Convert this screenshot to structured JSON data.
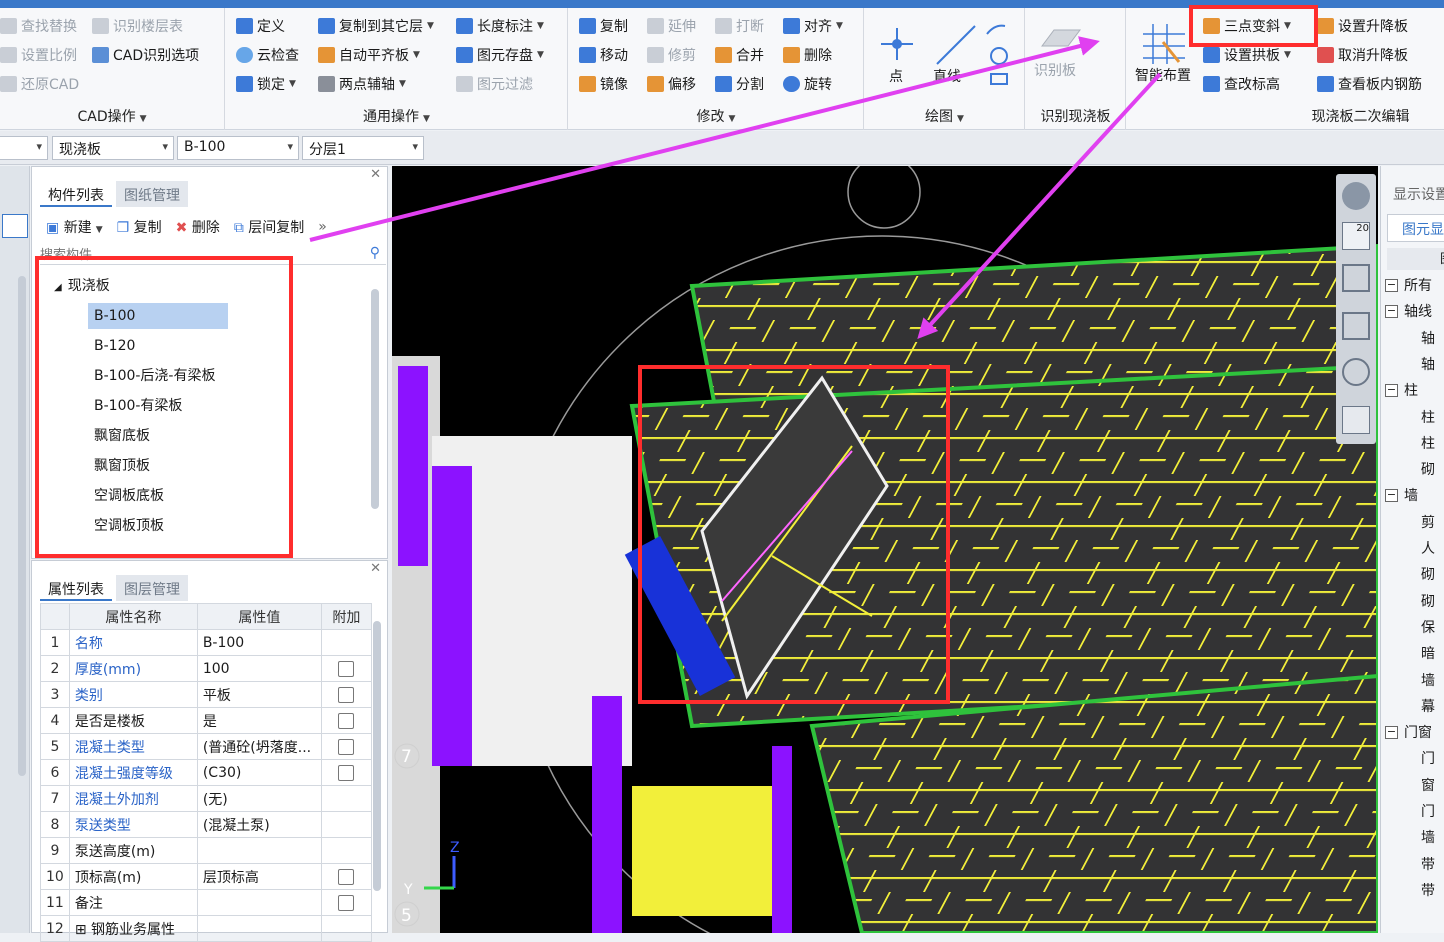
{
  "ribbon": {
    "cad_group": {
      "label": "CAD操作",
      "items": [
        "查找替换",
        "识别楼层表",
        "设置比例",
        "CAD识别选项",
        "还原CAD"
      ]
    },
    "general_group": {
      "label": "通用操作",
      "items": [
        "定义",
        "复制到其它层",
        "云检查",
        "自动平齐板",
        "锁定",
        "两点辅轴",
        "长度标注",
        "图元存盘",
        "图元过滤"
      ]
    },
    "modify_group": {
      "label": "修改",
      "items": [
        "复制",
        "延伸",
        "打断",
        "对齐",
        "移动",
        "修剪",
        "合并",
        "删除",
        "镜像",
        "偏移",
        "分割",
        "旋转"
      ]
    },
    "draw_group": {
      "label": "绘图",
      "point": "点",
      "line": "直线"
    },
    "recognize_group": {
      "label": "识别现浇板",
      "recognize_btn": "识别板"
    },
    "edit_group": {
      "label": "现浇板二次编辑",
      "smart_layout": "智能布置",
      "three_point_slope": "三点变斜",
      "set_up_down_slab": "设置升降板",
      "set_arch_slab": "设置拱板",
      "cancel_up_down_slab": "取消升降板",
      "change_elevation": "查改标高",
      "view_rebar": "查看板内钢筋"
    }
  },
  "selectors": [
    "现浇板",
    "B-100",
    "分层1"
  ],
  "component_panel": {
    "tabs": [
      "构件列表",
      "图纸管理"
    ],
    "toolbar": {
      "new": "新建",
      "copy": "复制",
      "delete": "删除",
      "floor_copy": "层间复制"
    },
    "search_placeholder": "搜索构件...",
    "tree_root": "现浇板",
    "items": [
      "B-100",
      "B-120",
      "B-100-后浇-有梁板",
      "B-100-有梁板",
      "飘窗底板",
      "飘窗顶板",
      "空调板底板",
      "空调板顶板"
    ]
  },
  "property_panel": {
    "tabs": [
      "属性列表",
      "图层管理"
    ],
    "headers": [
      "属性名称",
      "属性值",
      "附加"
    ],
    "rows": [
      {
        "no": "1",
        "name": "名称",
        "value": "B-100"
      },
      {
        "no": "2",
        "name": "厚度(mm)",
        "value": "100"
      },
      {
        "no": "3",
        "name": "类别",
        "value": "平板"
      },
      {
        "no": "4",
        "name": "是否是楼板",
        "value": "是"
      },
      {
        "no": "5",
        "name": "混凝土类型",
        "value": "(普通砼(坍落度..."
      },
      {
        "no": "6",
        "name": "混凝土强度等级",
        "value": "(C30)"
      },
      {
        "no": "7",
        "name": "混凝土外加剂",
        "value": "(无)"
      },
      {
        "no": "8",
        "name": "泵送类型",
        "value": "(混凝土泵)"
      },
      {
        "no": "9",
        "name": "泵送高度(m)",
        "value": ""
      },
      {
        "no": "10",
        "name": "顶标高(m)",
        "value": "层顶标高"
      },
      {
        "no": "11",
        "name": "备注",
        "value": ""
      },
      {
        "no": "12",
        "name": "钢筋业务属性",
        "value": ""
      }
    ]
  },
  "viewport": {
    "axis_7": "7",
    "axis_5": "5",
    "axis_z": "Z",
    "axis_y": "Y",
    "nav_20": "20"
  },
  "right_panel": {
    "title": "显示设置",
    "tab": "图元显示",
    "header": "图",
    "rows": [
      "所有",
      "轴线",
      "轴",
      "轴",
      "柱",
      "柱",
      "柱",
      "砌",
      "墙",
      "剪",
      "人",
      "砌",
      "砌",
      "保",
      "暗",
      "墙",
      "幕",
      "门窗",
      "门",
      "窗",
      "门",
      "墙",
      "带",
      "带"
    ]
  },
  "colors": {
    "annotation": "#ff2d2d",
    "arrow": "#e040f0",
    "accent": "#3a78c9"
  }
}
